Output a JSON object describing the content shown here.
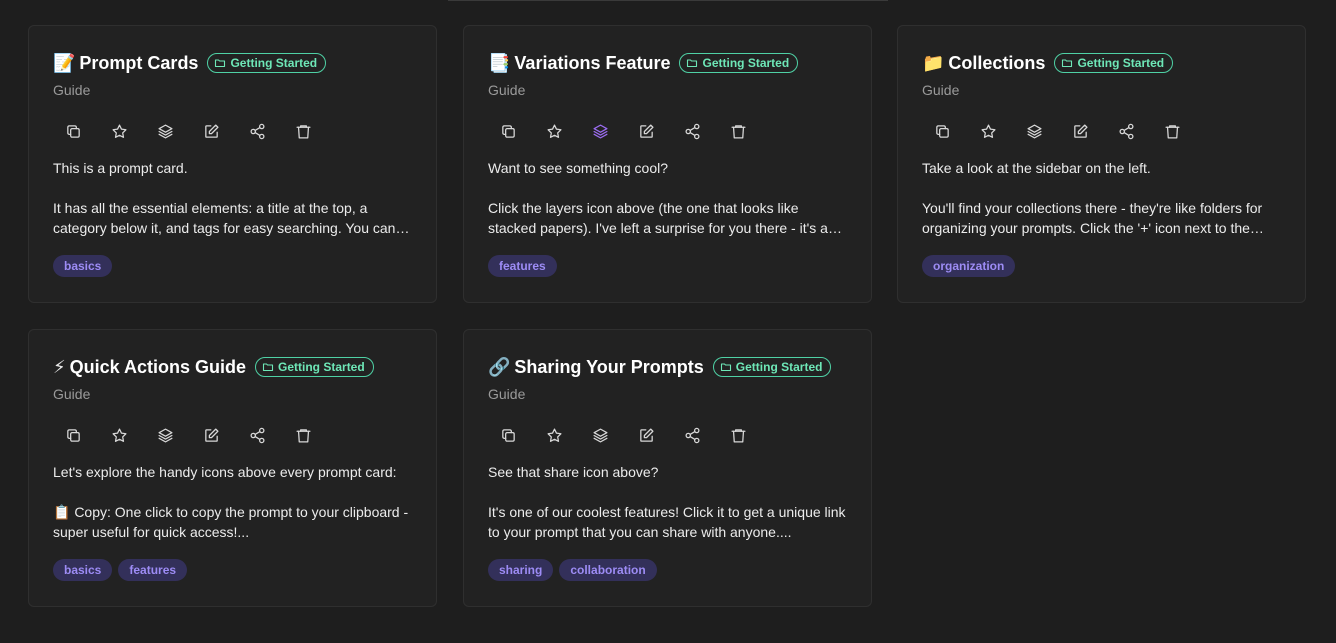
{
  "cards": [
    {
      "emoji": "📝",
      "title": "Prompt Cards",
      "collection": "Getting Started",
      "subtitle": "Guide",
      "intro": "This is a prompt card.",
      "detail": "It has all the essential elements: a title at the top, a category below it, and tags for easy searching. You can also see the action icons above this text for quick access to common tasks.",
      "tags": [
        "basics"
      ]
    },
    {
      "emoji": "📑",
      "title": "Variations Feature",
      "collection": "Getting Started",
      "subtitle": "Guide",
      "intro": "Want to see something cool?",
      "detail": "Click the layers icon above (the one that looks like stacked papers). I've left a surprise for you there - it's a variation of this very prompt so you can see how variations work.",
      "tags": [
        "features"
      ]
    },
    {
      "emoji": "📁",
      "title": "Collections",
      "collection": "Getting Started",
      "subtitle": "Guide",
      "intro": "Take a look at the sidebar on the left.",
      "detail": "You'll find your collections there - they're like folders for organizing your prompts. Click the '+' icon next to the collections heading to create a new one.",
      "tags": [
        "organization"
      ]
    },
    {
      "emoji": "⚡",
      "title": "Quick Actions Guide",
      "collection": "Getting Started",
      "subtitle": "Guide",
      "intro": "Let's explore the handy icons above every prompt card:",
      "detail": "📋 Copy: One click to copy the prompt to your clipboard - super useful for quick access!...",
      "tags": [
        "basics",
        "features"
      ]
    },
    {
      "emoji": "🔗",
      "title": "Sharing Your Prompts",
      "collection": "Getting Started",
      "subtitle": "Guide",
      "intro": "See that share icon above?",
      "detail": "It's one of our coolest features! Click it to get a unique link to your prompt that you can share with anyone....",
      "tags": [
        "sharing",
        "collaboration"
      ]
    }
  ],
  "action_icons": [
    "copy-icon",
    "star-icon",
    "layers-icon",
    "edit-icon",
    "share-icon",
    "trash-icon"
  ],
  "colors": {
    "background": "#1e1e1e",
    "card": "#222222",
    "badge_border": "#4fd1a5",
    "badge_text": "#6ee7b7",
    "tag_bg": "#33305a",
    "tag_text": "#9d8cf5",
    "active_icon": "#9b6cf0"
  }
}
